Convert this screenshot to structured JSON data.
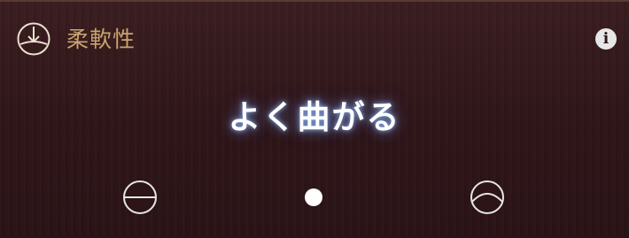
{
  "header": {
    "title": "柔軟性",
    "icon": "circle-down-arrow-icon",
    "title_color": "#c9a46e"
  },
  "info_button": {
    "label": "i"
  },
  "value_label": "よく曲がる",
  "slider": {
    "value": 0.5,
    "track_color": "#e8b800",
    "left_end_icon": "circle-line-icon",
    "right_end_icon": "circle-curved-line-icon"
  }
}
